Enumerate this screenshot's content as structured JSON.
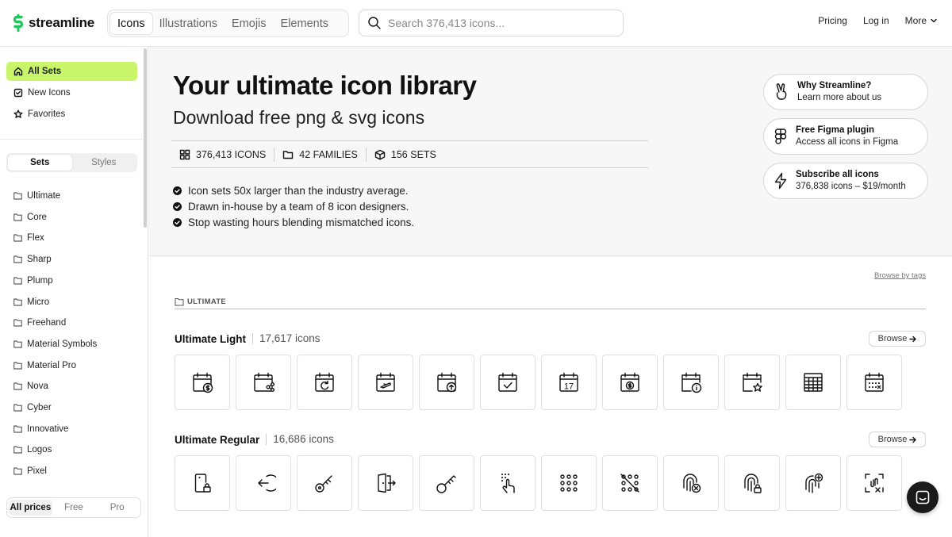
{
  "brand": {
    "name": "streamline",
    "accent": "#c8f56a",
    "logo_color": "#22c55e"
  },
  "topbar": {
    "tabs": [
      {
        "label": "Icons",
        "active": true
      },
      {
        "label": "Illustrations",
        "active": false
      },
      {
        "label": "Emojis",
        "active": false
      },
      {
        "label": "Elements",
        "active": false
      }
    ],
    "search_placeholder": "Search 376,413 icons...",
    "nav": {
      "pricing": "Pricing",
      "login": "Log in",
      "more": "More"
    }
  },
  "sidebar": {
    "top_items": [
      {
        "label": "All Sets",
        "icon": "home-icon",
        "active": true
      },
      {
        "label": "New Icons",
        "icon": "check-square-icon",
        "active": false
      },
      {
        "label": "Favorites",
        "icon": "star-icon",
        "active": false
      }
    ],
    "segment": {
      "sets": "Sets",
      "styles": "Styles",
      "selected": "Sets"
    },
    "sets": [
      "Ultimate",
      "Core",
      "Flex",
      "Sharp",
      "Plump",
      "Micro",
      "Freehand",
      "Material Symbols",
      "Material Pro",
      "Nova",
      "Cyber",
      "Innovative",
      "Logos",
      "Pixel"
    ],
    "prices": {
      "all": "All prices",
      "free": "Free",
      "pro": "Pro",
      "selected": "All prices"
    }
  },
  "hero": {
    "title": "Your ultimate icon library",
    "subtitle": "Download free png & svg icons",
    "stats": [
      {
        "label": "376,413 ICONS",
        "icon": "grid-icon"
      },
      {
        "label": "42 FAMILIES",
        "icon": "folder-icon"
      },
      {
        "label": "156 SETS",
        "icon": "cube-icon"
      }
    ],
    "bullets": [
      "Icon sets 50x larger than the industry average.",
      "Drawn in-house by a team of 8 icon designers.",
      "Stop wasting hours blending mismatched icons."
    ],
    "promos": [
      {
        "title": "Why Streamline?",
        "subtitle": "Learn more about us",
        "icon": "peace-hand-icon"
      },
      {
        "title": "Free Figma plugin",
        "subtitle": "Access all icons in Figma",
        "icon": "figma-icon"
      },
      {
        "title": "Subscribe all icons",
        "subtitle": "376,838 icons – $19/month",
        "icon": "lightning-icon"
      }
    ]
  },
  "main": {
    "browse_tags": "Browse by tags",
    "family": "ULTIMATE",
    "sets": [
      {
        "name": "Ultimate Light",
        "count": "17,617 icons",
        "browse": "Browse",
        "icons": [
          "calendar-dollar-icon",
          "calendar-share-icon",
          "calendar-refresh-icon",
          "calendar-plane-icon",
          "calendar-upload-icon",
          "calendar-check-icon",
          "calendar-17-icon",
          "calendar-coin-icon",
          "calendar-info-icon",
          "calendar-star-icon",
          "calendar-grid-icon",
          "calendar-dots-icon"
        ],
        "calendar_day": "17"
      },
      {
        "name": "Ultimate Regular",
        "count": "16,686 icons",
        "browse": "Browse",
        "icons": [
          "phone-lock-icon",
          "login-arrow-icon",
          "key-icon",
          "door-exit-icon",
          "key-round-icon",
          "touch-gesture-icon",
          "keypad-icon",
          "keypad-off-icon",
          "fingerprint-x-icon",
          "fingerprint-lock-icon",
          "fingerprint-scan-icon",
          "face-id-x-icon"
        ]
      }
    ]
  }
}
